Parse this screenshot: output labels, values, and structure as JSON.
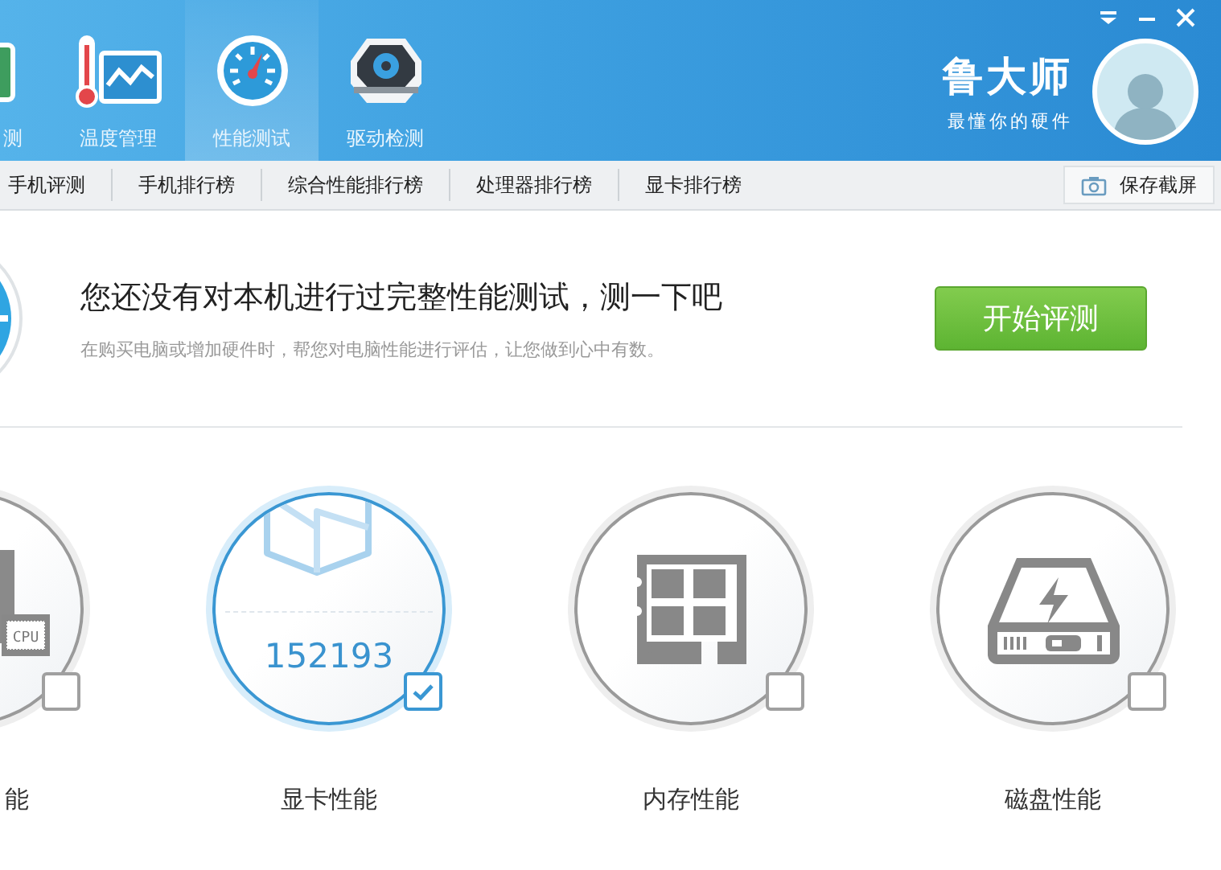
{
  "tabs": [
    {
      "label": "测",
      "kind": "hardware",
      "selected": false
    },
    {
      "label": "温度管理",
      "kind": "temperature",
      "selected": false
    },
    {
      "label": "性能测试",
      "kind": "performance",
      "selected": true
    },
    {
      "label": "驱动检测",
      "kind": "driver",
      "selected": false
    }
  ],
  "brand": {
    "name": "鲁大师",
    "slogan": "最懂你的硬件"
  },
  "subnav": {
    "items": [
      "手机评测",
      "手机排行榜",
      "综合性能排行榜",
      "处理器排行榜",
      "显卡排行榜"
    ],
    "save_button": "保存截屏"
  },
  "banner": {
    "heading": "您还没有对本机进行过完整性能测试，测一下吧",
    "subtitle": "在购买电脑或增加硬件时，帮您对电脑性能进行评估，让您做到心中有数。",
    "button": "开始评测"
  },
  "cards": [
    {
      "kind": "cpu",
      "label": "能",
      "chip_text": "CPU",
      "checked": false
    },
    {
      "kind": "gpu",
      "label": "显卡性能",
      "score": "152193",
      "checked": true
    },
    {
      "kind": "memory",
      "label": "内存性能",
      "checked": false
    },
    {
      "kind": "disk",
      "label": "磁盘性能",
      "checked": false
    }
  ]
}
